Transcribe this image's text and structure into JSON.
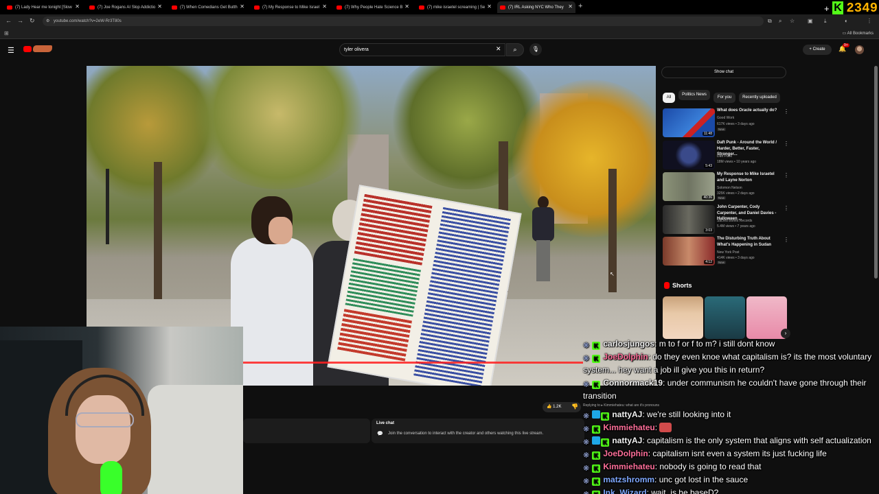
{
  "browser": {
    "tabs": [
      {
        "title": "(7) Lady Hear me tonight [Slow",
        "active": false
      },
      {
        "title": "(7) Joe Rogans AI Slop Addictio",
        "active": false
      },
      {
        "title": "(7) When Comedians Get Butth",
        "active": false
      },
      {
        "title": "(7) My Response to Mike Israel",
        "active": false
      },
      {
        "title": "(7) Why People Hate Science B",
        "active": false
      },
      {
        "title": "(7) mike israetel screaming | Se",
        "active": false
      },
      {
        "title": "(7) IRL Asking NYC Who They",
        "active": true
      }
    ],
    "url": "youtube.com/watch?v=2eW-Rr3T80s",
    "all_bookmarks": "All Bookmarks",
    "kick_count": "2349"
  },
  "youtube": {
    "search_value": "tyler olivera",
    "create_label": "Create",
    "notif_count": "9+",
    "show_chat": "Show chat",
    "chips": [
      "All",
      "Politics News",
      "For you",
      "Recently uploaded"
    ],
    "like_count": "1.2K",
    "live_chat": {
      "title": "Live chat",
      "text": "Join the conversation to interact with the creator and others watching this live stream."
    },
    "videos": [
      {
        "title": "What does Oracle actually do?",
        "channel": "Good Work",
        "meta": "617K views • 3 days ago",
        "badge": "New",
        "duration": "11:48"
      },
      {
        "title": "Daft Punk - Around the World / Harder, Better, Faster, Stronger...",
        "channel": "Daft Punk",
        "meta": "18M views • 10 years ago",
        "badge": "",
        "duration": "5:43"
      },
      {
        "title": "My Response to Mike Israetel and Layne Norton",
        "channel": "Solomon Nelson",
        "meta": "325K views • 2 days ago",
        "badge": "New",
        "duration": "40:36"
      },
      {
        "title": "John Carpenter, Cody Carpenter, and Daniel Davies - Halloween ...",
        "channel": "Sacred Bones Records",
        "meta": "5.4M views • 7 years ago",
        "badge": "",
        "duration": "3:03"
      },
      {
        "title": "The Disturbing Truth About What's Happening in Sudan",
        "channel": "New York Post",
        "meta": "414K views • 3 days ago",
        "badge": "New",
        "duration": "4:12"
      }
    ],
    "shorts_title": "Shorts"
  },
  "chat": {
    "messages": [
      {
        "user": "carlosjungos",
        "color": "#f1f1f1",
        "badges": [
          "star",
          "k"
        ],
        "text": "m to f or f to m? i still dont know"
      },
      {
        "user": "JoeDolphin",
        "color": "#ff6f9a",
        "badges": [
          "star",
          "k"
        ],
        "text": "do they even knoe what capitalism is? its the most voluntary system... hey want a job ill give you this in return?"
      },
      {
        "user": "Connormack19",
        "color": "#f1f1f1",
        "badges": [
          "star",
          "k"
        ],
        "text": "under communism he couldn't have gone through their transition"
      },
      {
        "user": "nattyAJ",
        "color": "#f1f1f1",
        "badges": [
          "star",
          "cube",
          "k"
        ],
        "text": "we're still looking into it"
      },
      {
        "user": "Kimmiehateu",
        "color": "#ff6f9a",
        "badges": [
          "star",
          "k"
        ],
        "text": "",
        "emote": true
      },
      {
        "user": "nattyAJ",
        "color": "#f1f1f1",
        "badges": [
          "star",
          "cube",
          "k"
        ],
        "text": "capitalism is the only system that aligns with self actualization"
      },
      {
        "user": "JoeDolphin",
        "color": "#ff6f9a",
        "badges": [
          "star",
          "k"
        ],
        "text": "capitalism isnt even a system its just fucking life"
      },
      {
        "user": "Kimmiehateu",
        "color": "#ff6f9a",
        "badges": [
          "star",
          "k"
        ],
        "text": "nobody is going to read that"
      },
      {
        "user": "matzshromm",
        "color": "#7fa8ff",
        "badges": [
          "star",
          "k"
        ],
        "text": "unc got lost in the sauce"
      },
      {
        "user": "Ink_Wizard",
        "color": "#7fa8ff",
        "badges": [
          "star",
          "k"
        ],
        "text": "wait, is he baseD?"
      }
    ],
    "reply_note": "Replying to ▸ Kimmiehateu: what are it's pronouns"
  }
}
